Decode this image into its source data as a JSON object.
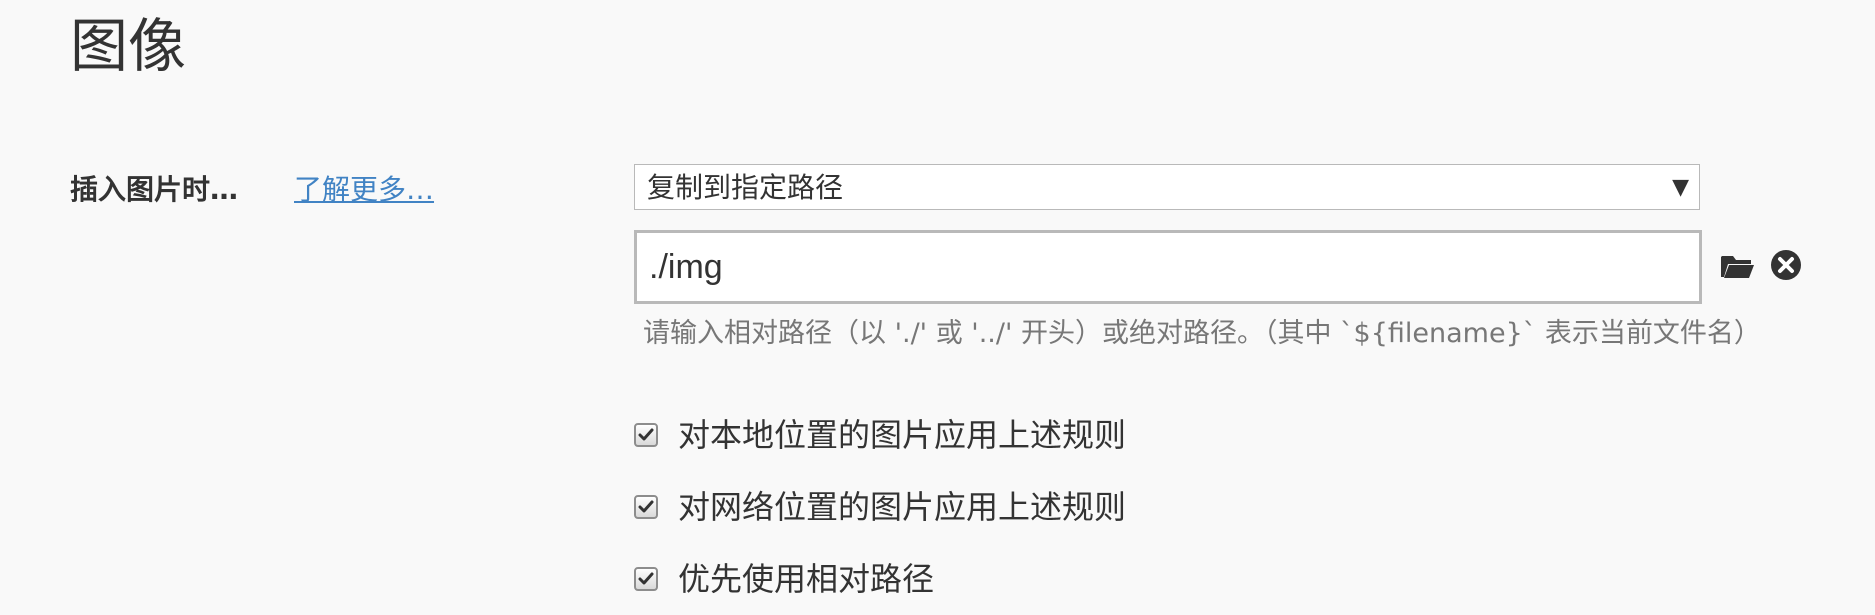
{
  "section": {
    "title": "图像"
  },
  "insert_image": {
    "label": "插入图片时…",
    "learn_more": "了解更多…",
    "action_select": {
      "value": "复制到指定路径",
      "arrow": "▼"
    },
    "path_input": {
      "value": "./img"
    },
    "hint": "请输入相对路径（以 './' 或 '../' 开头）或绝对路径。（其中 `${filename}` 表示当前文件名）"
  },
  "options": [
    {
      "label": "对本地位置的图片应用上述规则",
      "checked": true
    },
    {
      "label": "对网络位置的图片应用上述规则",
      "checked": true
    },
    {
      "label": "优先使用相对路径",
      "checked": true
    }
  ],
  "icons": {
    "folder": "folder-open-icon",
    "clear": "clear-circle-icon",
    "check": "checkmark-icon"
  },
  "colors": {
    "background": "#f9f9f9",
    "text": "#333333",
    "link": "#4183c4",
    "hint": "#777777",
    "border": "#b9b9b9"
  }
}
